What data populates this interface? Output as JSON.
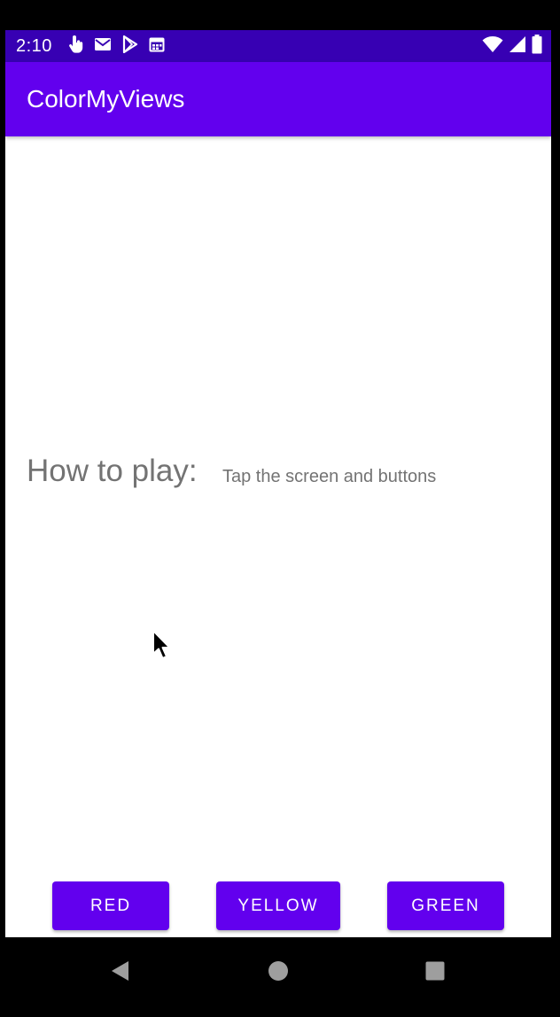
{
  "status_bar": {
    "time": "2:10",
    "left_icons": [
      "touch-icon",
      "mail-icon",
      "play-store-icon",
      "calendar-icon"
    ],
    "right_icons": [
      "wifi-icon",
      "cell-signal-icon",
      "battery-icon"
    ]
  },
  "app_bar": {
    "title": "ColorMyViews"
  },
  "content": {
    "how_to_play_label": "How to play:",
    "how_to_play_text": "Tap the screen and buttons"
  },
  "buttons": {
    "red_label": "RED",
    "yellow_label": "YELLOW",
    "green_label": "GREEN"
  },
  "nav_bar": {
    "icons": [
      "back-icon",
      "home-icon",
      "recents-icon"
    ]
  },
  "colors": {
    "status_bar": "#3700b3",
    "primary": "#6200ee",
    "text_secondary": "#737373",
    "background": "#ffffff"
  }
}
